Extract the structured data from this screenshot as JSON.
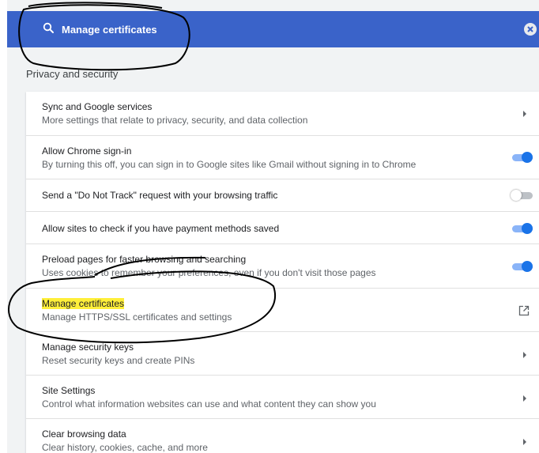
{
  "search": {
    "value": "Manage certificates"
  },
  "section_title": "Privacy and security",
  "colors": {
    "search_bar": "#3a63c9",
    "toggle_on": "#1a73e8",
    "highlight": "#ffef3a"
  },
  "rows": [
    {
      "title": "Sync and Google services",
      "subtitle": "More settings that relate to privacy, security, and data collection",
      "control": "chevron-right-icon"
    },
    {
      "title": "Allow Chrome sign-in",
      "subtitle": "By turning this off, you can sign in to Google sites like Gmail without signing in to Chrome",
      "control": "toggle",
      "enabled": true
    },
    {
      "title": "Send a \"Do Not Track\" request with your browsing traffic",
      "control": "toggle",
      "enabled": false
    },
    {
      "title": "Allow sites to check if you have payment methods saved",
      "control": "toggle",
      "enabled": true
    },
    {
      "title": "Preload pages for faster browsing and searching",
      "subtitle": "Uses cookies to remember your preferences, even if you don't visit those pages",
      "control": "toggle",
      "enabled": true
    },
    {
      "title": "Manage certificates",
      "subtitle": "Manage HTTPS/SSL certificates and settings",
      "control": "open-in-new-icon",
      "highlighted": true
    },
    {
      "title": "Manage security keys",
      "subtitle": "Reset security keys and create PINs",
      "control": "chevron-right-icon"
    },
    {
      "title": "Site Settings",
      "subtitle": "Control what information websites can use and what content they can show you",
      "control": "chevron-right-icon"
    },
    {
      "title": "Clear browsing data",
      "subtitle": "Clear history, cookies, cache, and more",
      "control": "chevron-right-icon"
    }
  ]
}
